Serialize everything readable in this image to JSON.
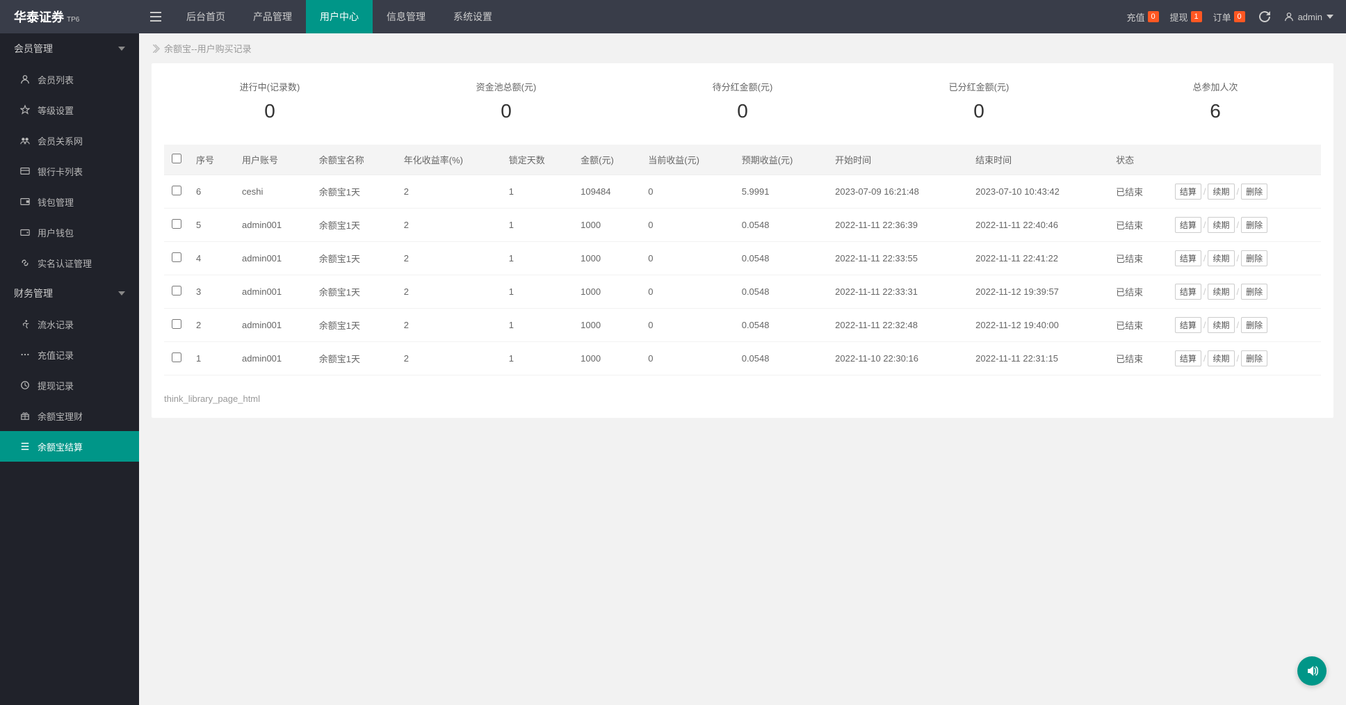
{
  "header": {
    "brand_main": "华泰证券",
    "brand_sup": "TP6",
    "nav": [
      {
        "label": "后台首页"
      },
      {
        "label": "产品管理"
      },
      {
        "label": "用户中心",
        "active": true
      },
      {
        "label": "信息管理"
      },
      {
        "label": "系统设置"
      }
    ],
    "right": {
      "recharge_label": "充值",
      "recharge_count": "0",
      "withdraw_label": "提现",
      "withdraw_count": "1",
      "order_label": "订单",
      "order_count": "0",
      "user_label": "admin"
    }
  },
  "sidebar": {
    "groups": [
      {
        "title": "会员管理",
        "open": true,
        "items": [
          {
            "icon": "user",
            "label": "会员列表"
          },
          {
            "icon": "star",
            "label": "等级设置"
          },
          {
            "icon": "group",
            "label": "会员关系网"
          },
          {
            "icon": "card",
            "label": "银行卡列表"
          },
          {
            "icon": "wallet",
            "label": "钱包管理"
          },
          {
            "icon": "wallet2",
            "label": "用户钱包"
          },
          {
            "icon": "link",
            "label": "实名认证管理"
          }
        ]
      },
      {
        "title": "财务管理",
        "open": true,
        "items": [
          {
            "icon": "run",
            "label": "流水记录"
          },
          {
            "icon": "dots",
            "label": "充值记录"
          },
          {
            "icon": "circle",
            "label": "提现记录"
          },
          {
            "icon": "gift",
            "label": "余额宝理财"
          },
          {
            "icon": "list",
            "label": "余额宝结算",
            "active": true
          }
        ]
      }
    ]
  },
  "breadcrumb": {
    "text": "余额宝--用户购买记录"
  },
  "stats": [
    {
      "label": "进行中(记录数)",
      "value": "0"
    },
    {
      "label": "资金池总额(元)",
      "value": "0"
    },
    {
      "label": "待分红金额(元)",
      "value": "0"
    },
    {
      "label": "已分红金额(元)",
      "value": "0"
    },
    {
      "label": "总参加人次",
      "value": "6"
    }
  ],
  "table": {
    "columns": [
      "序号",
      "用户账号",
      "余额宝名称",
      "年化收益率(%)",
      "锁定天数",
      "金额(元)",
      "当前收益(元)",
      "预期收益(元)",
      "开始时间",
      "结束时间",
      "状态",
      ""
    ],
    "rows": [
      {
        "seq": "6",
        "acct": "ceshi",
        "name": "余额宝1天",
        "rate": "2",
        "days": "1",
        "amt": "109484",
        "cur": "0",
        "exp": "5.9991",
        "start": "2023-07-09 16:21:48",
        "end": "2023-07-10 10:43:42",
        "status": "已结束"
      },
      {
        "seq": "5",
        "acct": "admin001",
        "name": "余额宝1天",
        "rate": "2",
        "days": "1",
        "amt": "1000",
        "cur": "0",
        "exp": "0.0548",
        "start": "2022-11-11 22:36:39",
        "end": "2022-11-11 22:40:46",
        "status": "已结束"
      },
      {
        "seq": "4",
        "acct": "admin001",
        "name": "余额宝1天",
        "rate": "2",
        "days": "1",
        "amt": "1000",
        "cur": "0",
        "exp": "0.0548",
        "start": "2022-11-11 22:33:55",
        "end": "2022-11-11 22:41:22",
        "status": "已结束"
      },
      {
        "seq": "3",
        "acct": "admin001",
        "name": "余额宝1天",
        "rate": "2",
        "days": "1",
        "amt": "1000",
        "cur": "0",
        "exp": "0.0548",
        "start": "2022-11-11 22:33:31",
        "end": "2022-11-12 19:39:57",
        "status": "已结束"
      },
      {
        "seq": "2",
        "acct": "admin001",
        "name": "余额宝1天",
        "rate": "2",
        "days": "1",
        "amt": "1000",
        "cur": "0",
        "exp": "0.0548",
        "start": "2022-11-11 22:32:48",
        "end": "2022-11-12 19:40:00",
        "status": "已结束"
      },
      {
        "seq": "1",
        "acct": "admin001",
        "name": "余额宝1天",
        "rate": "2",
        "days": "1",
        "amt": "1000",
        "cur": "0",
        "exp": "0.0548",
        "start": "2022-11-10 22:30:16",
        "end": "2022-11-11 22:31:15",
        "status": "已结束"
      }
    ],
    "actions": {
      "settle": "结算",
      "renew": "续期",
      "delete": "删除"
    }
  },
  "pager": {
    "text": "think_library_page_html"
  }
}
